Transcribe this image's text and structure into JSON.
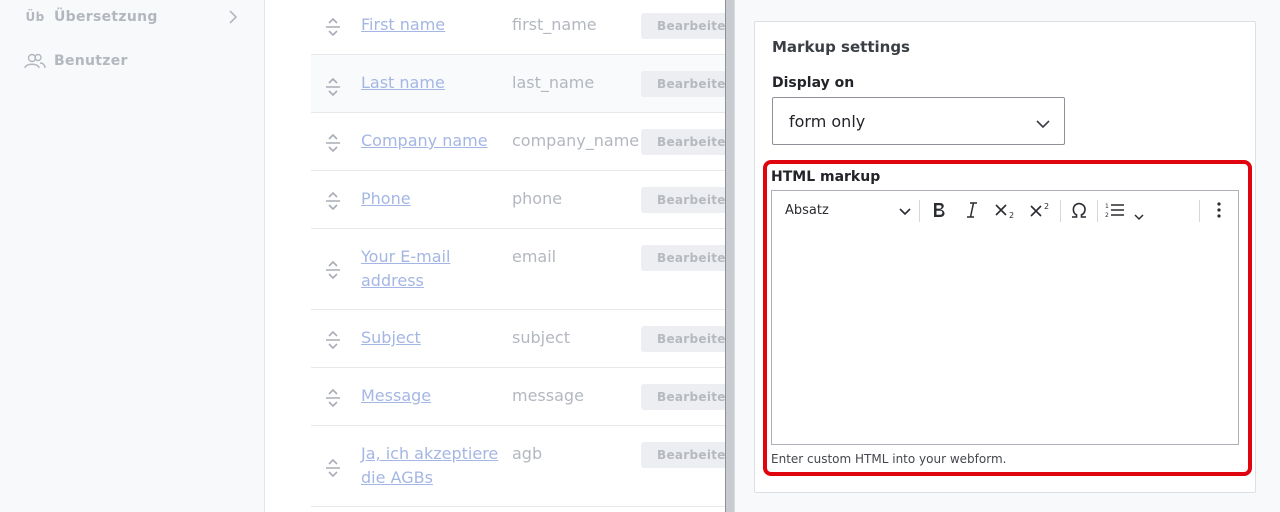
{
  "sidebar": {
    "items": [
      {
        "icon_text": "Üb",
        "label": "Übersetzung",
        "has_chevron": true
      },
      {
        "icon": "users-icon",
        "label": "Benutzer"
      }
    ]
  },
  "fields": {
    "rows": [
      {
        "title": "First name",
        "machine_name": "first_name",
        "edit_label": "Bearbeiten"
      },
      {
        "title": "Last name",
        "machine_name": "last_name",
        "edit_label": "Bearbeiten"
      },
      {
        "title": "Company name",
        "machine_name": "company_name",
        "edit_label": "Bearbeiten"
      },
      {
        "title": "Phone",
        "machine_name": "phone",
        "edit_label": "Bearbeiten"
      },
      {
        "title_line1": "Your E-mail",
        "title_line2": "address",
        "machine_name": "email",
        "edit_label": "Bearbeiten"
      },
      {
        "title": "Subject",
        "machine_name": "subject",
        "edit_label": "Bearbeiten"
      },
      {
        "title": "Message",
        "machine_name": "message",
        "edit_label": "Bearbeiten"
      },
      {
        "title_line1": "Ja, ich akzeptiere",
        "title_line2": "die AGBs",
        "machine_name": "agb",
        "edit_label": "Bearbeiten"
      }
    ]
  },
  "panel": {
    "title": "Markup settings",
    "display_on": {
      "label": "Display on",
      "value": "form only"
    },
    "html_markup": {
      "label": "HTML markup",
      "toolbar": {
        "heading_select": "Absatz",
        "buttons": [
          "bold-icon",
          "italic-icon",
          "subscript-icon",
          "superscript-icon",
          "special-characters-icon",
          "numbered-list-icon",
          "more-options-icon"
        ]
      },
      "content": "",
      "help_text": "Enter custom HTML into your webform."
    }
  },
  "colors": {
    "highlight_frame": "#e0040e",
    "link": "#a4b6e4",
    "muted_text": "#b3b7bf"
  }
}
